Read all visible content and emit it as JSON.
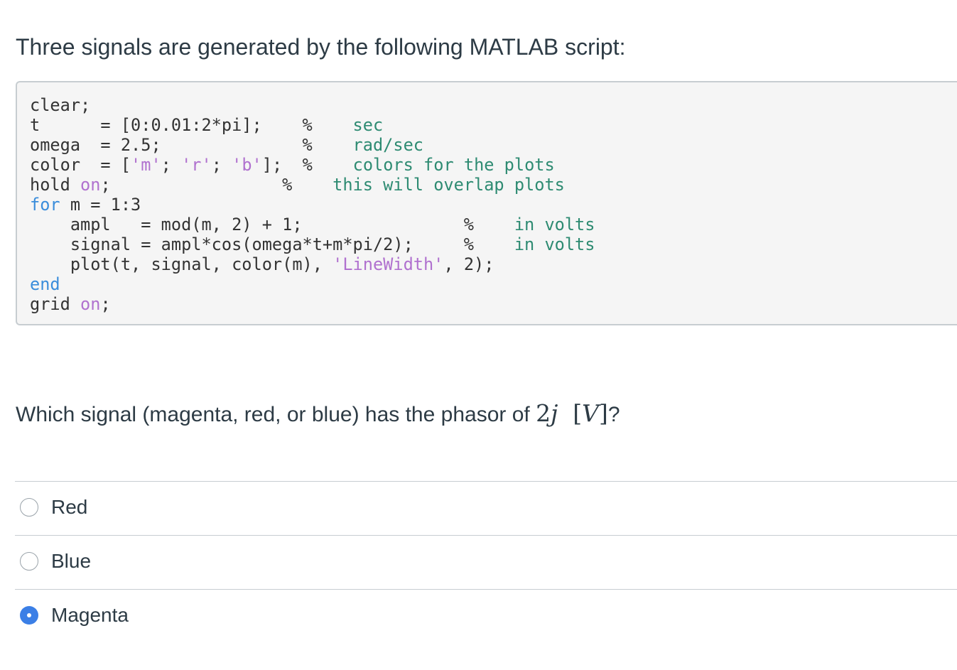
{
  "intro_text": "Three signals are generated by the following MATLAB script:",
  "code": {
    "lines": [
      [
        {
          "t": "clear;",
          "c": ""
        }
      ],
      [
        {
          "t": "t        = [0:0.01:2*pi];    %   sec",
          "c": ""
        }
      ],
      [
        {
          "t": "omega    = 2.5;              %   rad/sec",
          "c": ""
        }
      ],
      [
        {
          "t": "color    = ['m'; 'r'; 'b'];  %   colors for the plots",
          "c": ""
        }
      ],
      [
        {
          "t": "hold on;                     %   this will overlap plots",
          "c": ""
        }
      ],
      [
        {
          "t": "for m = 1:3",
          "c": ""
        }
      ]
    ]
  },
  "code_segments": [
    [
      [
        "",
        "clear;"
      ]
    ],
    [
      [
        "",
        "t      = [0:0.01:2*pi];    % "
      ],
      [
        "cm",
        "   sec"
      ]
    ],
    [
      [
        "",
        "omega  = 2.5;              % "
      ],
      [
        "cm",
        "   rad/sec"
      ]
    ],
    [
      [
        "",
        "color  = ["
      ],
      [
        "str",
        "'m'"
      ],
      [
        "",
        "; "
      ],
      [
        "str",
        "'r'"
      ],
      [
        "",
        "; "
      ],
      [
        "str",
        "'b'"
      ],
      [
        "",
        "];  % "
      ],
      [
        "cm",
        "   colors for the plots"
      ]
    ],
    [
      [
        "",
        "hold "
      ],
      [
        "str",
        "on"
      ],
      [
        "",
        ";                 % "
      ],
      [
        "cm",
        "   this will overlap plots"
      ]
    ],
    [
      [
        "kw",
        "for"
      ],
      [
        "",
        " m = 1:3"
      ]
    ],
    [
      [
        "",
        "    ampl   = mod(m, 2) + 1;                % "
      ],
      [
        "cm",
        "   in volts"
      ]
    ],
    [
      [
        "",
        "    signal = ampl*cos(omega*t+m*pi/2);     % "
      ],
      [
        "cm",
        "   in volts"
      ]
    ],
    [
      [
        "",
        "    plot(t, signal, color(m), "
      ],
      [
        "str",
        "'LineWidth'"
      ],
      [
        "",
        ", 2);"
      ]
    ],
    [
      [
        "kw",
        "end"
      ]
    ],
    [
      [
        "",
        "grid "
      ],
      [
        "str",
        "on"
      ],
      [
        "",
        ";"
      ]
    ]
  ],
  "question": {
    "prefix": "Which signal (magenta, red, or blue) has the phasor of ",
    "math_number": "2",
    "math_var": "j",
    "math_unit": "V",
    "suffix": "?"
  },
  "answers": [
    {
      "label": "Red",
      "selected": false
    },
    {
      "label": "Blue",
      "selected": false
    },
    {
      "label": "Magenta",
      "selected": true
    }
  ],
  "colors": {
    "keyword": "#3a8ddb",
    "string": "#b071cf",
    "comment": "#2e8b72",
    "radio_selected": "#3b7fe6"
  }
}
